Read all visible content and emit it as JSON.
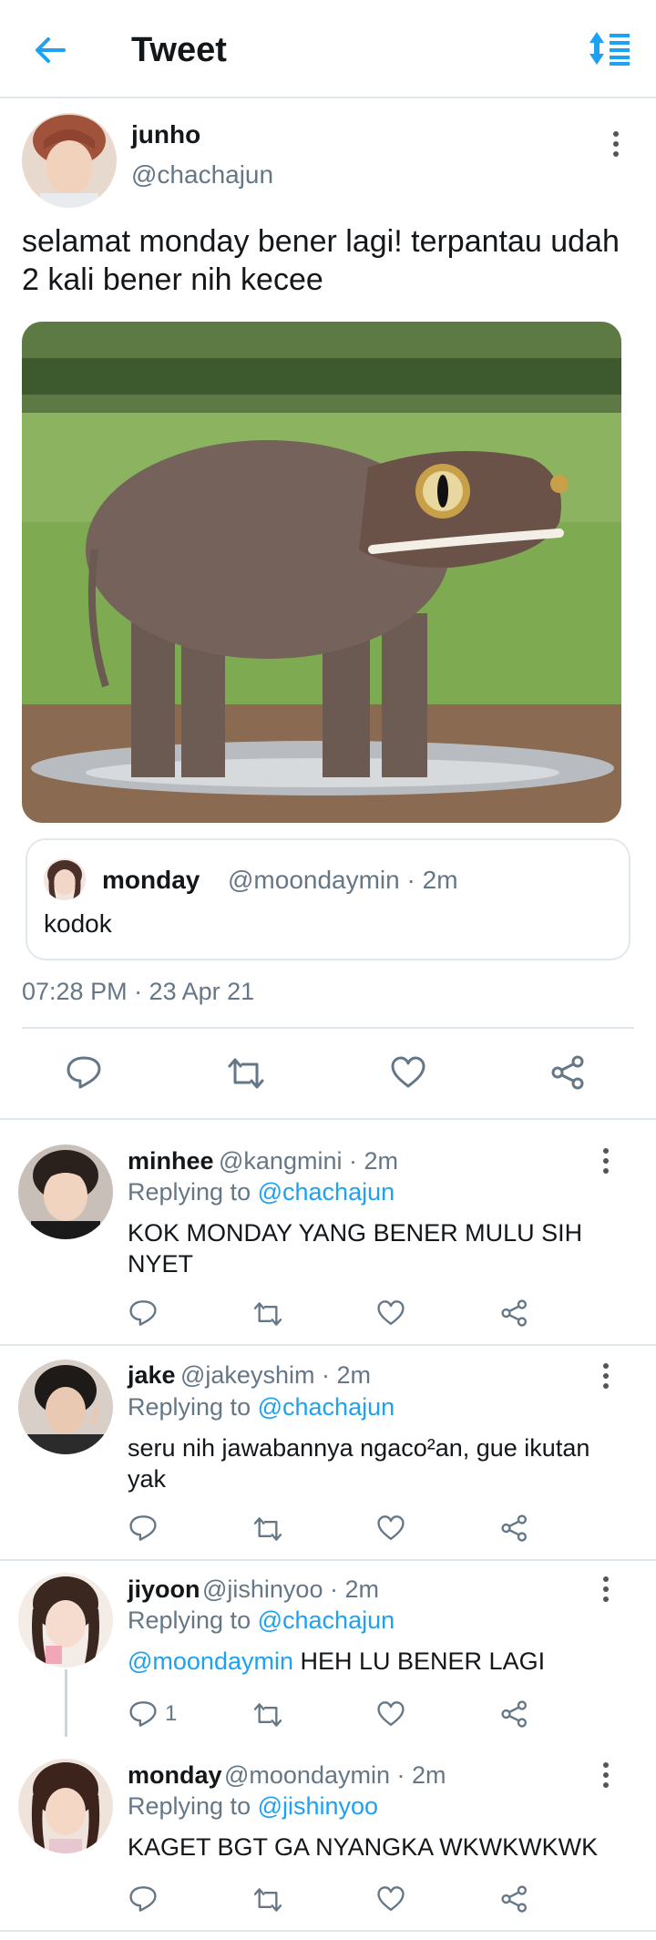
{
  "header": {
    "title": "Tweet",
    "back_icon": "arrow-left-icon",
    "sort_icon": "sort-icon",
    "accent": "#1da1f2"
  },
  "tweet": {
    "name": "junho",
    "handle": "@chachajun",
    "text": "selamat monday bener lagi! terpantau udah 2 kali bener nih kecee",
    "media_alt_icon": "photo-elephant-frog",
    "quote": {
      "name": "monday",
      "handle": "@moondaymin",
      "time": "· 2m",
      "text": "kodok"
    },
    "timestamp": "07:28 PM · 23 Apr 21",
    "actions": [
      "reply-icon",
      "retweet-icon",
      "like-icon",
      "share-icon"
    ]
  },
  "replies": [
    {
      "name": "minhee",
      "handle": "@kangmini",
      "time": "· 2m",
      "replying_prefix": "Replying to",
      "replying_to": "@chachajun",
      "mention": "",
      "text": "KOK MONDAY YANG BENER MULU SIH NYET",
      "reply_count": ""
    },
    {
      "name": "jake",
      "handle": "@jakeyshim",
      "time": "· 2m",
      "replying_prefix": "Replying to",
      "replying_to": "@chachajun",
      "mention": "",
      "text": "seru nih jawabannya ngaco²an, gue ikutan yak",
      "reply_count": ""
    },
    {
      "name": "jiyoon",
      "handle": "@jishinyoo",
      "time": "· 2m",
      "replying_prefix": "Replying to",
      "replying_to": "@chachajun",
      "mention": "@moondaymin",
      "text": " HEH LU BENER LAGI",
      "reply_count": "1"
    },
    {
      "name": "monday",
      "handle": "@moondaymin",
      "time": "· 2m",
      "replying_prefix": "Replying to",
      "replying_to": "@jishinyoo",
      "mention": "",
      "text": "KAGET BGT GA NYANGKA WKWKWKWK",
      "reply_count": ""
    }
  ]
}
